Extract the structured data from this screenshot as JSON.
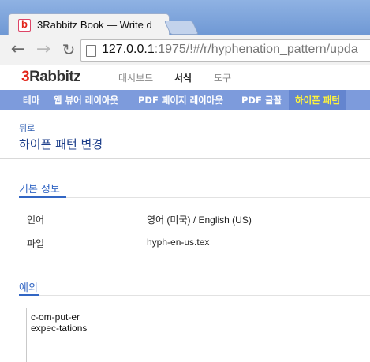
{
  "browser": {
    "tab_title": "3Rabbitz Book — Write d",
    "url_host": "127.0.0.1",
    "url_rest": ":1975/!#/r/hyphenation_pattern/upda"
  },
  "app": {
    "logo_three": "3",
    "logo_rest": "Rabbitz",
    "topnav": [
      "대시보드",
      "서식",
      "도구"
    ],
    "subnav": [
      "테마",
      "웹 뷰어 레이아웃",
      "PDF 페이지 레이아웃",
      "PDF 글꼴",
      "하이픈 패턴"
    ]
  },
  "content": {
    "back": "뒤로",
    "title": "하이픈 패턴 변경",
    "basic_section": "기본 정보",
    "language_label": "언어",
    "language_value": "영어 (미국) / English (US)",
    "file_label": "파일",
    "file_value": "hyph-en-us.tex",
    "exceptions_section": "예외",
    "exceptions_text": "c-om-put-er\nexpec-tations"
  }
}
